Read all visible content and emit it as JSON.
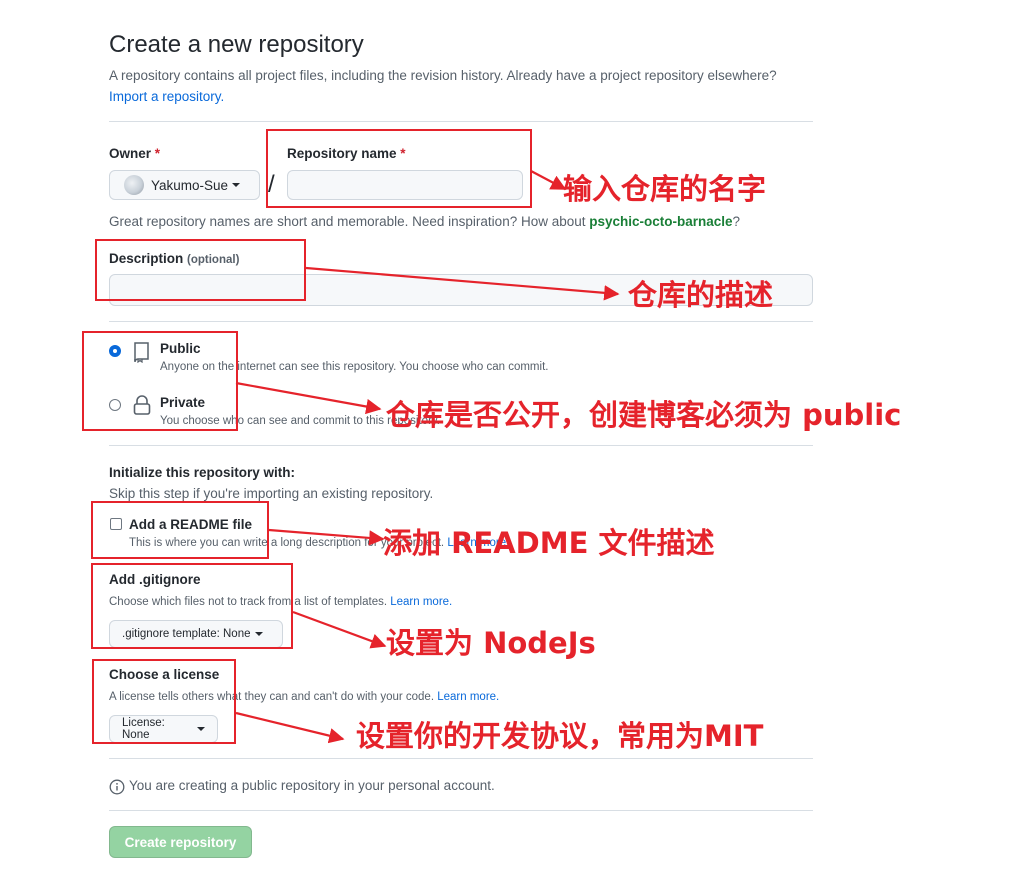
{
  "header": {
    "title": "Create a new repository",
    "subtitle": "A repository contains all project files, including the revision history. Already have a project repository elsewhere?",
    "import_link": "Import a repository."
  },
  "owner": {
    "label": "Owner",
    "required_mark": "*",
    "value": "Yakumo-Sue"
  },
  "separator": "/",
  "repo_name": {
    "label": "Repository name",
    "required_mark": "*",
    "value": "",
    "placeholder": ""
  },
  "name_hint": {
    "prefix": "Great repository names are short and memorable. Need inspiration? How about ",
    "suggestion": "psychic-octo-barnacle",
    "suffix": "?"
  },
  "description": {
    "label": "Description",
    "optional": "(optional)",
    "value": ""
  },
  "visibility": {
    "selected": "Public",
    "options": [
      {
        "label": "Public",
        "desc": "Anyone on the internet can see this repository. You choose who can commit."
      },
      {
        "label": "Private",
        "desc": "You choose who can see and commit to this repository."
      }
    ]
  },
  "initialize": {
    "title": "Initialize this repository with:",
    "subtitle": "Skip this step if you're importing an existing repository.",
    "readme_label": "Add a README file",
    "readme_desc": "This is where you can write a long description for your project.",
    "readme_link": "Learn more.",
    "readme_checked": false
  },
  "gitignore": {
    "title": "Add .gitignore",
    "desc": "Choose which files not to track from a list of templates.",
    "link": "Learn more.",
    "button": ".gitignore template: None"
  },
  "license": {
    "title": "Choose a license",
    "desc": "A license tells others what they can and can't do with your code.",
    "link": "Learn more.",
    "button": "License: None"
  },
  "notice": "You are creating a public repository in your personal account.",
  "create_button": "Create repository",
  "annotations": {
    "repo_name": "输入仓库的名字",
    "description": "仓库的描述",
    "visibility": "仓库是否公开，创建博客必须为 public",
    "readme": "添加 README 文件描述",
    "gitignore": "设置为 NodeJs",
    "license": "设置你的开发协议，常用为MIT"
  },
  "colors": {
    "accent_blue": "#0969da",
    "annotation_red": "#e5232b",
    "create_button_disabled": "#94d3a2",
    "required_red": "#cf222e",
    "suggestion_green": "#1a7f37"
  }
}
